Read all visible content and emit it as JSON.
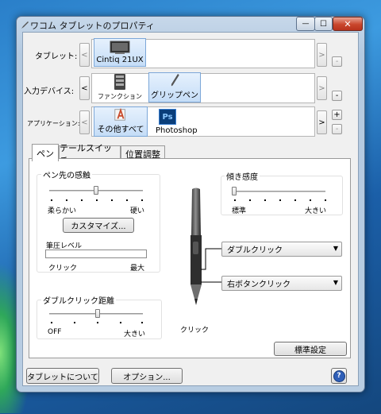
{
  "window": {
    "title": "ワコム タブレットのプロパティ",
    "min_glyph": "—",
    "max_glyph": "☐",
    "close_glyph": "✕"
  },
  "rows": {
    "tablet": {
      "label": "タブレット:",
      "left_arrow": "<",
      "right_arrow": ">",
      "remove": "-",
      "items": [
        {
          "label": "Cintiq 21UX",
          "icon": "monitor-icon",
          "selected": true
        }
      ]
    },
    "input_device": {
      "label": "入力デバイス:",
      "left_arrow": "<",
      "right_arrow": ">",
      "remove": "-",
      "items": [
        {
          "label": "ファンクション",
          "icon": "function-keys-icon",
          "selected": false
        },
        {
          "label": "グリップペン",
          "icon": "pen-icon",
          "selected": true
        }
      ]
    },
    "application": {
      "label": "アプリケーション:",
      "left_arrow": "<",
      "right_arrow": ">",
      "add": "+",
      "remove": "-",
      "items": [
        {
          "label": "その他すべて",
          "icon": "all-apps-icon",
          "selected": true
        },
        {
          "label": "Photoshop",
          "icon": "photoshop-icon",
          "badge": "Ps",
          "selected": false
        }
      ]
    }
  },
  "tabs": [
    {
      "label": "ペン",
      "active": true
    },
    {
      "label": "テールスイッチ",
      "active": false
    },
    {
      "label": "位置調整",
      "active": false
    }
  ],
  "pen": {
    "tip_feel": {
      "title": "ペン先の感触",
      "min_label": "柔らかい",
      "max_label": "硬い",
      "value_fraction": 0.42,
      "customize_button": "カスタマイズ..."
    },
    "pressure": {
      "title": "筆圧レベル",
      "left_label": "クリック",
      "right_label": "最大"
    },
    "tilt": {
      "title": "傾き感度",
      "min_label": "標準",
      "max_label": "大きい",
      "value_fraction": 0.0
    },
    "double_click_distance": {
      "title": "ダブルクリック距離",
      "min_label": "OFF",
      "max_label": "大きい",
      "value_fraction": 0.5
    },
    "upper_button": "ダブルクリック",
    "lower_button": "右ボタンクリック",
    "tip_label": "クリック",
    "default_button": "標準設定"
  },
  "footer": {
    "about_button": "タブレットについて",
    "options_button": "オプション...",
    "help_glyph": "?"
  },
  "colors": {
    "selection": "#c5ddf7",
    "close": "#c9462c",
    "help": "#2f5fb8",
    "photoshop": "#0a3e7a"
  }
}
